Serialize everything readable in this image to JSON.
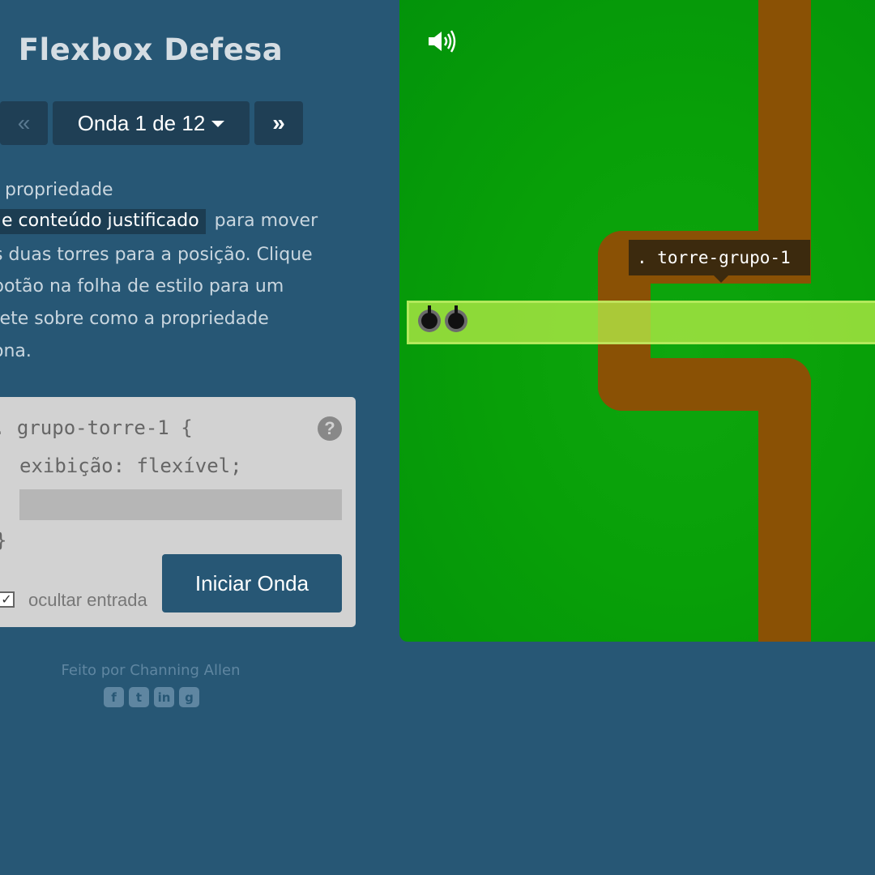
{
  "app": {
    "title": "Flexbox Defesa"
  },
  "nav": {
    "prev_label": "«",
    "wave_label": "Onda 1 de 12",
    "next_label": "»"
  },
  "instructions": {
    "line1": "propriedade",
    "line2_highlight": "e conteúdo justificado",
    "line2_rest": "para mover",
    "line3": "s duas torres para a posição. Clique",
    "line4": "botão na folha de estilo para um",
    "line5": "rete sobre como a propriedade",
    "line6": "ona."
  },
  "editor": {
    "selector_line": ". grupo-torre-1 {",
    "declaration_line": "exibição: flexível;",
    "closing_line": "}",
    "answer_value": "",
    "help_label": "?",
    "start_button_label": "Iniciar Onda",
    "hide_input_label": "ocultar entrada",
    "hide_input_checked": true
  },
  "footer": {
    "credit": "Feito por Channing Allen",
    "socials": [
      "facebook-icon",
      "twitter-icon",
      "linkedin-icon",
      "github-icon"
    ]
  },
  "board": {
    "sound_icon": "speaker-icon",
    "tooltip_label": ". torre-grupo-1",
    "tower_count": 2,
    "colors": {
      "grass": "#08a008",
      "path": "#8a5105",
      "highlight": "#b4eb46"
    }
  }
}
